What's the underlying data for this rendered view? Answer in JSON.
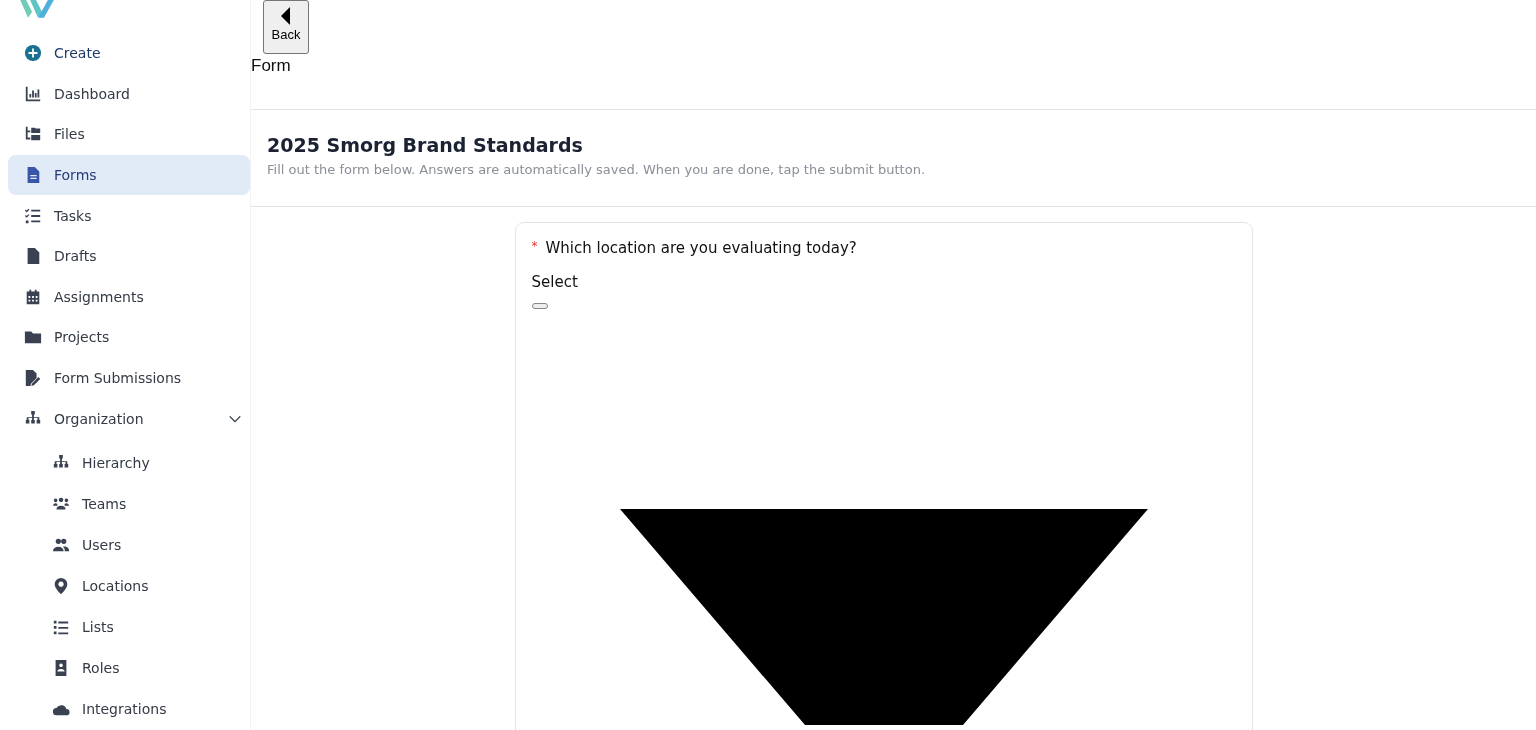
{
  "back_button": {
    "label": "Back"
  },
  "page_label": "Form",
  "sidebar": {
    "items": [
      {
        "label": "Create",
        "kind": "action",
        "selected": false
      },
      {
        "label": "Dashboard",
        "kind": "link",
        "selected": false
      },
      {
        "label": "Files",
        "kind": "link",
        "selected": false
      },
      {
        "label": "Forms",
        "kind": "link",
        "selected": true
      },
      {
        "label": "Tasks",
        "kind": "link",
        "selected": false
      },
      {
        "label": "Drafts",
        "kind": "link",
        "selected": false
      },
      {
        "label": "Assignments",
        "kind": "link",
        "selected": false
      },
      {
        "label": "Projects",
        "kind": "link",
        "selected": false
      },
      {
        "label": "Form Submissions",
        "kind": "link",
        "selected": false
      },
      {
        "label": "Organization",
        "kind": "group",
        "selected": false,
        "expanded": true,
        "children": [
          {
            "label": "Hierarchy",
            "selected": false
          },
          {
            "label": "Teams",
            "selected": false
          },
          {
            "label": "Users",
            "selected": false
          },
          {
            "label": "Locations",
            "selected": false
          },
          {
            "label": "Lists",
            "selected": false
          },
          {
            "label": "Roles",
            "selected": false
          },
          {
            "label": "Integrations",
            "selected": false
          }
        ]
      }
    ]
  },
  "form": {
    "title": "2025 Smorg Brand Standards",
    "subtitle": "Fill out the form below. Answers are automatically saved. When you are done, tap the submit button.",
    "questions": [
      {
        "label": "Which location are you evaluating today?",
        "required": true,
        "required_mark": "*",
        "select_label": "Select"
      }
    ]
  }
}
